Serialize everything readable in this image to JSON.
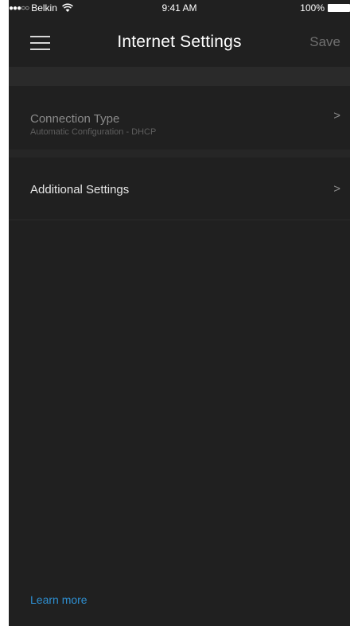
{
  "status_bar": {
    "signal": "●●●○○",
    "carrier": "Belkin",
    "time": "9:41 AM",
    "battery_percent": "100%"
  },
  "nav": {
    "title": "Internet Settings",
    "save_label": "Save",
    "menu_icon": "hamburger-menu-icon"
  },
  "list": {
    "items": [
      {
        "label": "Connection Type",
        "sublabel": "Automatic Configuration - DHCP",
        "chevron": ">"
      },
      {
        "label": "Additional Settings",
        "chevron": ">"
      }
    ]
  },
  "footer": {
    "learn_more": "Learn more"
  },
  "colors": {
    "background": "#202020",
    "section_band": "#2a2a2a",
    "link": "#2e8fd1",
    "save_disabled": "#6f6f6f"
  }
}
